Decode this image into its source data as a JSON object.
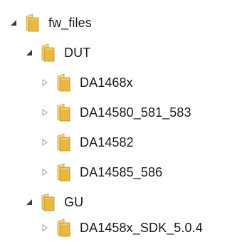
{
  "tree": {
    "root": {
      "label": "fw_files",
      "expanded": true,
      "children": [
        {
          "label": "DUT",
          "expanded": true,
          "children": [
            {
              "label": "DA1468x",
              "expanded": false
            },
            {
              "label": "DA14580_581_583",
              "expanded": false
            },
            {
              "label": "DA14582",
              "expanded": false
            },
            {
              "label": "DA14585_586",
              "expanded": false
            }
          ]
        },
        {
          "label": "GU",
          "expanded": true,
          "children": [
            {
              "label": "DA1458x_SDK_5.0.4",
              "expanded": false
            }
          ]
        }
      ]
    }
  },
  "icons": {
    "expanded": "expanded-triangle-icon",
    "collapsed": "collapsed-triangle-icon",
    "folder": "folder-icon"
  },
  "colors": {
    "folder_front": "#e8b843",
    "folder_back": "#f6d97a",
    "arrow_expanded": "#3a3a3a",
    "arrow_collapsed": "#9a9a9a"
  }
}
